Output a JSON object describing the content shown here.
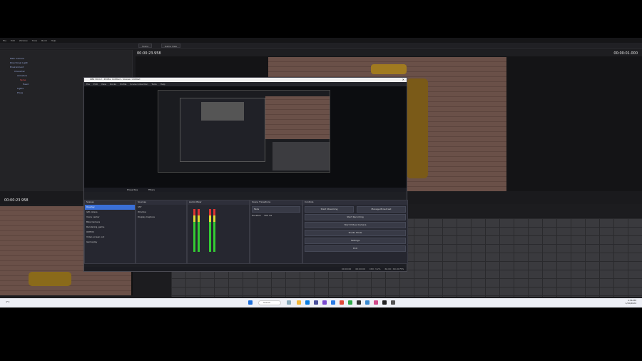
{
  "editor": {
    "menus": [
      "File",
      "Edit",
      "Window",
      "Tools",
      "Build",
      "Help"
    ],
    "tabs": [
      "Scene",
      "Game View"
    ],
    "time_left": "00:00:23.958",
    "time_right": "00:00:01.000",
    "lower_time": "00:00:23.958",
    "outliner_rows": [
      "Main Camera",
      "Directional Light",
      "Environment",
      "Character",
      "Armature",
      "Spine",
      "Head",
      "Lights",
      "Props"
    ]
  },
  "obs": {
    "title": "OBS 30.0.2 - Profile: Untitled - Scenes: Untitled",
    "menus": [
      "File",
      "Edit",
      "View",
      "Docks",
      "Profile",
      "Scene Collection",
      "Tools",
      "Help"
    ],
    "source_toolbar": [
      "Properties",
      "Filters"
    ],
    "scenes_header": "Scenes",
    "scenes": [
      "Overlay",
      "left videos",
      "Voice center",
      "Bike Camera",
      "Rendering_game",
      "ONTOS",
      "Video screen out",
      "Gameplay"
    ],
    "sources_header": "Sources",
    "sources": [
      "SST",
      "Window",
      "Display Capture"
    ],
    "mixer_header": "Audio Mixer",
    "transitions_header": "Scene Transitions",
    "transition_value": "Fade",
    "duration_label": "Duration",
    "duration_value": "300 ms",
    "controls_header": "Controls",
    "controls": [
      "Start Streaming",
      "Manage Broadcast",
      "Start Recording",
      "Start Virtual Camera",
      "Studio Mode",
      "Settings",
      "Exit"
    ],
    "status": [
      "00:00:00",
      "00:00:00",
      "CPU: 3.2%",
      "60.00 / 60.00 FPS"
    ]
  },
  "taskbar": {
    "search_placeholder": "Search",
    "time": "4:56 PM",
    "date": "1/20/2024",
    "weather": "4°C"
  },
  "colors": {
    "accent": "#3a6fd8",
    "background": "#1c1c1f"
  }
}
